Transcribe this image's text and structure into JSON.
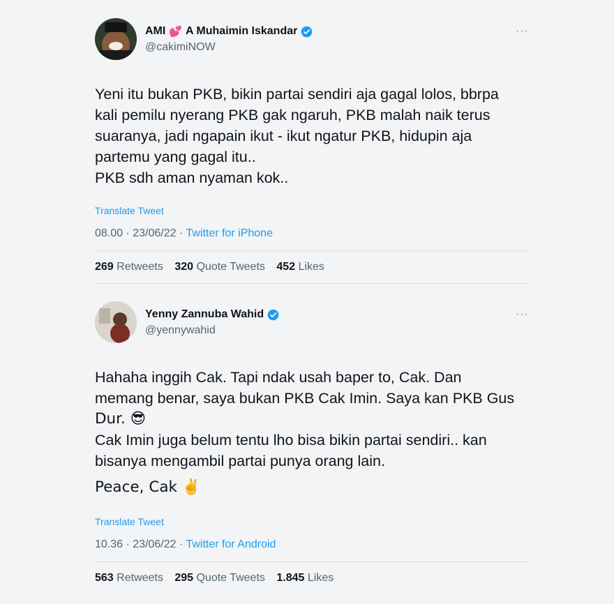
{
  "tweets": [
    {
      "name": "A Muhaimin Iskandar",
      "name_prefix": "AMI",
      "name_heart": "💕",
      "handle": "@cakimiNOW",
      "more": "···",
      "body_lines": [
        "Yeni itu bukan PKB, bikin partai sendiri aja gagal lolos, bbrpa",
        "kali pemilu nyerang PKB gak ngaruh, PKB malah naik terus",
        "suaranya, jadi ngapain ikut - ikut ngatur PKB, hidupin aja",
        "partemu yang gagal itu..",
        "PKB sdh aman nyaman kok.."
      ],
      "translate": "Translate Tweet",
      "time": "08.00 · 23/06/22 · ",
      "source": "Twitter for iPhone",
      "retweets": "269",
      "retweets_label": "Retweets",
      "quotes": "320",
      "quotes_label": "Quote Tweets",
      "likes": "452",
      "likes_label": "Likes"
    },
    {
      "name": "Yenny Zannuba Wahid",
      "handle": "@yennywahid",
      "more": "···",
      "body_lines": [
        "Hahaha inggih Cak. Tapi ndak usah baper to, Cak. Dan",
        "memang benar, saya bukan PKB Cak Imin. Saya kan PKB Gus",
        "Dur. 😎",
        "Cak Imin juga belum tentu lho bisa bikin partai sendiri.. kan",
        "bisanya mengambil  partai punya orang lain."
      ],
      "body_extra": "Peace, Cak ✌️",
      "translate": "Translate Tweet",
      "time": "10.36 · 23/06/22 · ",
      "source": "Twitter for Android",
      "retweets": "563",
      "retweets_label": "Retweets",
      "quotes": "295",
      "quotes_label": "Quote Tweets",
      "likes": "1.845",
      "likes_label": "Likes"
    }
  ],
  "colors": {
    "link": "#1d9bf0",
    "secondary_text": "#536471",
    "primary_text": "#0f1419",
    "divider": "#dde2e6",
    "background": "#f3f4f5"
  },
  "icons": {
    "verified": "verified-badge-icon",
    "more": "more-options-icon"
  }
}
